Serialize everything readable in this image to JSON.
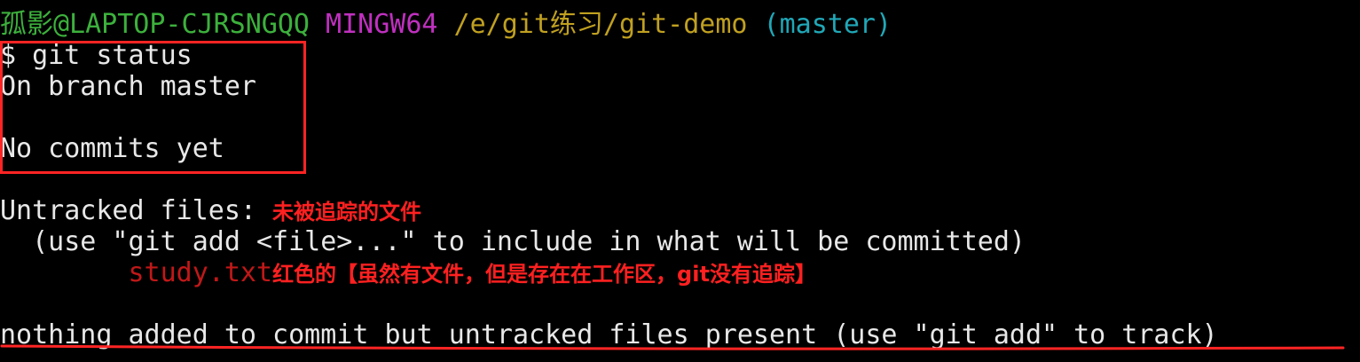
{
  "terminal": {
    "prompt": {
      "user_host": "孤影@LAPTOP-CJRSNGQQ",
      "shell": "MINGW64",
      "path": "/e/git练习/git-demo",
      "branch": "(master)"
    },
    "command": "$ git status",
    "output": {
      "branch_line": "On branch master",
      "commits_line": "No commits yet",
      "untracked_header": "Untracked files:",
      "use_hint": "  (use \"git add <file>...\" to include in what will be committed)",
      "file_indent": "        ",
      "untracked_file": "study.txt",
      "summary": "nothing added to commit but untracked files present (use \"git add\" to track)"
    },
    "annotations": {
      "untracked_note": "未被追踪的文件",
      "file_note": "红色的【虽然有文件，但是存在在工作区，git没有追踪】"
    },
    "colors": {
      "background": "#000000",
      "text": "#e8e8e8",
      "user_host": "#3cb13c",
      "shell": "#c030c0",
      "path": "#c0a020",
      "branch": "#20a8b8",
      "untracked_file": "#c01818",
      "annotation": "#ff2020"
    }
  }
}
